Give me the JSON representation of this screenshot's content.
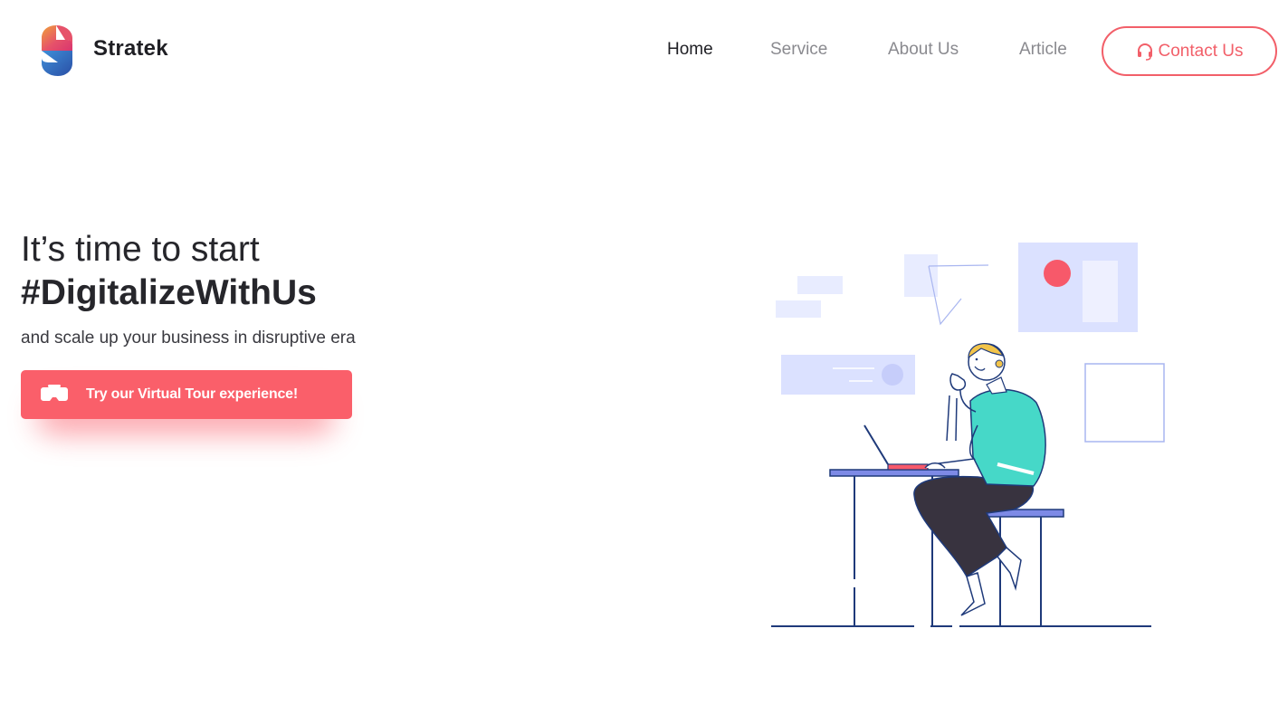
{
  "header": {
    "brand": "Stratek",
    "logo_icon": "stratek-s-logo",
    "nav": [
      {
        "label": "Home",
        "active": true
      },
      {
        "label": "Service",
        "active": false
      },
      {
        "label": "About Us",
        "active": false
      },
      {
        "label": "Article",
        "active": false
      }
    ],
    "contact": {
      "label": "Contact Us",
      "icon": "headset-icon"
    }
  },
  "hero": {
    "headline_line1": "It’s time to start",
    "headline_line2": "#DigitalizeWithUs",
    "subtitle": "and scale up your business in disruptive era",
    "cta": {
      "label": "Try our Virtual Tour experience!",
      "icon": "vr-headset-icon"
    },
    "illustration": "person-working-on-laptop-illustration"
  },
  "colors": {
    "accent": "#fa5f6a",
    "text_dark": "#26262b",
    "nav_muted": "#8a8a8f",
    "illustration_line": "#1f3a7a",
    "illustration_shirt": "#46d8c8",
    "illustration_panel": "#dde3ff"
  }
}
